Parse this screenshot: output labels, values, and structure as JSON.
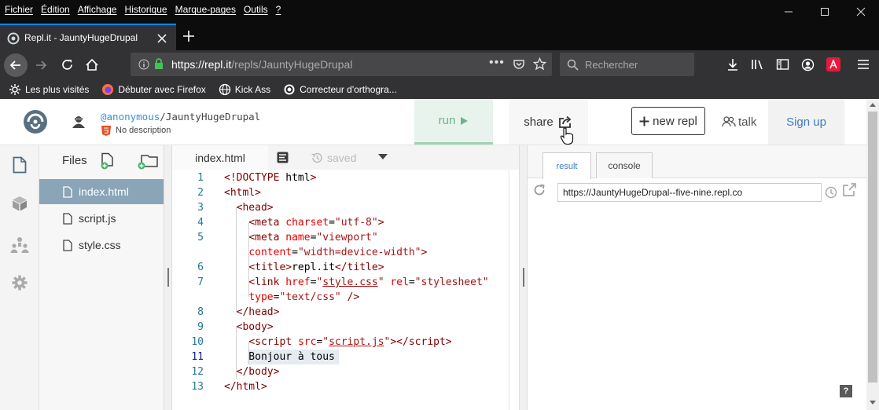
{
  "browser": {
    "menu": [
      "Fichier",
      "Édition",
      "Affichage",
      "Historique",
      "Marque-pages",
      "Outils",
      "?"
    ],
    "tab_title": "Repl.it - JauntyHugeDrupal",
    "url_prefix": "https://repl.it",
    "url_path": "/repls/JauntyHugeDrupal",
    "search_placeholder": "Rechercher",
    "bookmarks": [
      "Les plus visités",
      "Débuter avec Firefox",
      "Kick Ass",
      "Correcteur d'orthogra..."
    ]
  },
  "header": {
    "user": "@anonymous",
    "repl_name": "/JauntyHugeDrupal",
    "description": "No description",
    "run_label": "run",
    "share_label": "share",
    "new_repl_label": "new repl",
    "talk_label": "talk",
    "signup_label": "Sign up"
  },
  "files": {
    "title": "Files",
    "items": [
      "index.html",
      "script.js",
      "style.css"
    ]
  },
  "editor": {
    "tab": "index.html",
    "status": "saved",
    "line_numbers": [
      "1",
      "2",
      "3",
      "4",
      "5",
      "",
      "6",
      "7",
      "",
      "8",
      "9",
      "10",
      "11",
      "12",
      "13"
    ]
  },
  "result": {
    "tabs": [
      "result",
      "console"
    ],
    "url": "https://JauntyHugeDrupal--five-nine.repl.co",
    "help": "?"
  },
  "colors": {
    "accent_blue": "#0a84ff",
    "run_green": "#6fb38a",
    "selected_file": "#8aa4b8",
    "link_blue": "#3d7bc7"
  }
}
